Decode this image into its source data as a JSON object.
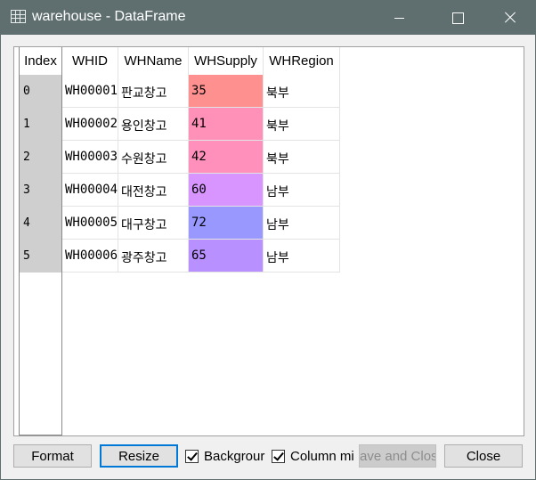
{
  "window": {
    "title": "warehouse - DataFrame",
    "icon": "table-icon"
  },
  "table": {
    "index_header": "Index",
    "columns": [
      "WHID",
      "WHName",
      "WHSupply",
      "WHRegion"
    ],
    "index": [
      "0",
      "1",
      "2",
      "3",
      "4",
      "5"
    ],
    "rows": [
      {
        "WHID": "WH00001",
        "WHName": "판교창고",
        "WHSupply": "35",
        "WHRegion": "북부"
      },
      {
        "WHID": "WH00002",
        "WHName": "용인창고",
        "WHSupply": "41",
        "WHRegion": "북부"
      },
      {
        "WHID": "WH00003",
        "WHName": "수원창고",
        "WHSupply": "42",
        "WHRegion": "북부"
      },
      {
        "WHID": "WH00004",
        "WHName": "대전창고",
        "WHSupply": "60",
        "WHRegion": "남부"
      },
      {
        "WHID": "WH00005",
        "WHName": "대구창고",
        "WHSupply": "72",
        "WHRegion": "남부"
      },
      {
        "WHID": "WH00006",
        "WHName": "광주창고",
        "WHSupply": "65",
        "WHRegion": "남부"
      }
    ],
    "supply_colors": [
      "#ff9090",
      "#ff90b8",
      "#ff90bc",
      "#d895ff",
      "#9898ff",
      "#b890ff"
    ]
  },
  "buttons": {
    "format": "Format",
    "resize": "Resize",
    "background_checkbox": "Backgrour",
    "column_min_checkbox": "Column mi",
    "save_close": "ave and Clos",
    "close": "Close"
  }
}
